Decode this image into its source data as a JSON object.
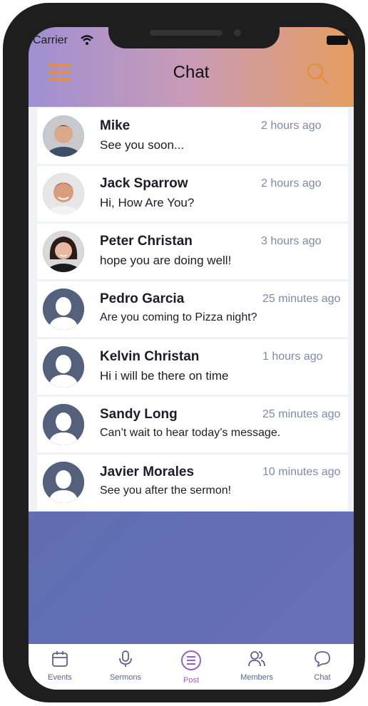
{
  "status_bar": {
    "carrier": "Carrier"
  },
  "header": {
    "title": "Chat"
  },
  "chats": [
    {
      "name": "Mike",
      "message": "See you soon...",
      "time": "2 hours ago",
      "avatar": "photo"
    },
    {
      "name": "Jack Sparrow",
      "message": "Hi, How Are You?",
      "time": "2 hours ago",
      "avatar": "photo"
    },
    {
      "name": "Peter Christan",
      "message": "hope you are doing well!",
      "time": "3 hours ago",
      "avatar": "photo"
    },
    {
      "name": "Pedro Garcia",
      "message": "Are you coming to Pizza night?",
      "time": "25 minutes ago",
      "avatar": "placeholder"
    },
    {
      "name": "Kelvin Christan",
      "message": "Hi i will be there on time",
      "time": "1 hours ago",
      "avatar": "placeholder"
    },
    {
      "name": "Sandy Long",
      "message": "Can’t wait to hear today’s message.",
      "time": "25 minutes ago",
      "avatar": "placeholder"
    },
    {
      "name": "Javier Morales",
      "message": "See you after the sermon!",
      "time": "10 minutes ago",
      "avatar": "placeholder"
    }
  ],
  "tabbar": {
    "items": [
      {
        "label": "Events",
        "icon": "calendar-icon"
      },
      {
        "label": "Sermons",
        "icon": "microphone-icon"
      },
      {
        "label": "Post",
        "icon": "post-menu-icon",
        "active": true
      },
      {
        "label": "Members",
        "icon": "members-icon"
      },
      {
        "label": "Chat",
        "icon": "chat-bubble-icon"
      }
    ]
  },
  "colors": {
    "accent_orange": "#e48d43",
    "header_gradient_start": "#a08fd2",
    "header_gradient_end": "#e59d60",
    "time_text": "#8089a8",
    "active_tab": "#9a5fc4",
    "avatar_placeholder": "#55607d"
  }
}
